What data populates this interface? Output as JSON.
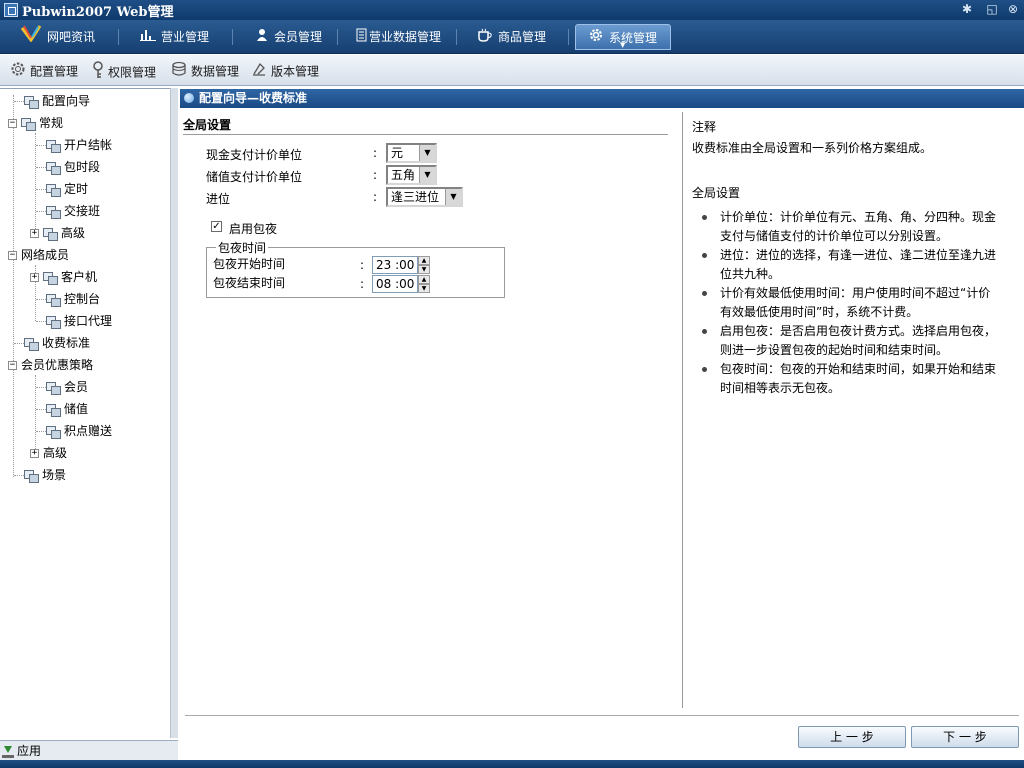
{
  "window": {
    "title": "Pubwin2007 Web管理"
  },
  "main_tabs": [
    {
      "label": "网吧资讯",
      "icon": "browser-logo-icon"
    },
    {
      "label": "营业管理",
      "icon": "bar-chart-icon"
    },
    {
      "label": "会员管理",
      "icon": "user-icon"
    },
    {
      "label": "营业数据管理",
      "icon": "document-icon"
    },
    {
      "label": "商品管理",
      "icon": "cup-icon"
    },
    {
      "label": "系统管理",
      "icon": "gear-icon",
      "active": true
    }
  ],
  "sub_toolbar": [
    {
      "label": "配置管理",
      "icon": "gear-icon"
    },
    {
      "label": "权限管理",
      "icon": "key-icon"
    },
    {
      "label": "数据管理",
      "icon": "database-icon"
    },
    {
      "label": "版本管理",
      "icon": "version-icon"
    }
  ],
  "tree": [
    {
      "label": "配置向导"
    },
    {
      "label": "常规",
      "expander": "⊟"
    },
    {
      "label": "开户结帐"
    },
    {
      "label": "包时段"
    },
    {
      "label": "定时"
    },
    {
      "label": "交接班"
    },
    {
      "label": "高级",
      "expander": "⊞"
    },
    {
      "label": "网络成员",
      "expander": "⊟"
    },
    {
      "label": "客户机",
      "expander": "⊞"
    },
    {
      "label": "控制台"
    },
    {
      "label": "接口代理"
    },
    {
      "label": "收费标准",
      "selected": true
    },
    {
      "label": "会员优惠策略",
      "expander": "⊟"
    },
    {
      "label": "会员"
    },
    {
      "label": "储值"
    },
    {
      "label": "积点赠送"
    },
    {
      "label": "高级",
      "expander": "⊞"
    },
    {
      "label": "场景"
    }
  ],
  "apply_label": "应用",
  "content": {
    "header": "配置向导—收费标准",
    "section_title": "全局设置",
    "fields": {
      "cash_unit": {
        "label": "现金支付计价单位",
        "value": "元"
      },
      "stored_unit": {
        "label": "储值支付计价单位",
        "value": "五角"
      },
      "rounding": {
        "label": "进位",
        "value": "逢三进位"
      }
    },
    "colon": ":",
    "overnight": {
      "checkbox_label": "启用包夜",
      "checked": true,
      "group_label": "包夜时间",
      "start": {
        "label": "包夜开始时间",
        "value": "23 :00"
      },
      "end": {
        "label": "包夜结束时间",
        "value": "08 :00"
      }
    },
    "buttons": {
      "prev": "上 一 步",
      "next": "下 一 步"
    }
  },
  "notes": {
    "title": "注释",
    "intro": "收费标准由全局设置和一系列价格方案组成。",
    "subtitle": "全局设置",
    "items": [
      "计价单位：计价单位有元、五角、角、分四种。现金支付与储值支付的计价单位可以分别设置。",
      "进位：进位的选择，有逢一进位、逢二进位至逢九进位共九种。",
      "计价有效最低使用时间：用户使用时间不超过“计价有效最低使用时间”时，系统不计费。",
      "启用包夜：是否启用包夜计费方式。选择启用包夜，则进一步设置包夜的起始时间和结束时间。",
      "包夜时间：包夜的开始和结束时间，如果开始和结束时间相等表示无包夜。"
    ]
  },
  "colors": {
    "title_bar": "#163f70",
    "accent": "#2f66a4",
    "tab_active": "#5a8cc7"
  }
}
